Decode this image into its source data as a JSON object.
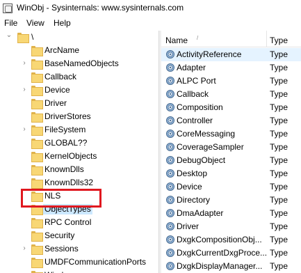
{
  "window": {
    "title": "WinObj - Sysinternals: www.sysinternals.com"
  },
  "menu": {
    "file": "File",
    "view": "View",
    "help": "Help"
  },
  "tree": {
    "root": {
      "label": "\\",
      "expand_glyph": "⌄"
    },
    "collapsed_glyph": "›",
    "selected": "ObjectTypes",
    "items": [
      {
        "label": "ArcName",
        "expandable": false
      },
      {
        "label": "BaseNamedObjects",
        "expandable": true
      },
      {
        "label": "Callback",
        "expandable": false
      },
      {
        "label": "Device",
        "expandable": true
      },
      {
        "label": "Driver",
        "expandable": false
      },
      {
        "label": "DriverStores",
        "expandable": false
      },
      {
        "label": "FileSystem",
        "expandable": true
      },
      {
        "label": "GLOBAL??",
        "expandable": false
      },
      {
        "label": "KernelObjects",
        "expandable": false
      },
      {
        "label": "KnownDlls",
        "expandable": false
      },
      {
        "label": "KnownDlls32",
        "expandable": false
      },
      {
        "label": "NLS",
        "expandable": false
      },
      {
        "label": "ObjectTypes",
        "expandable": false
      },
      {
        "label": "RPC Control",
        "expandable": false
      },
      {
        "label": "Security",
        "expandable": false
      },
      {
        "label": "Sessions",
        "expandable": true
      },
      {
        "label": "UMDFCommunicationPorts",
        "expandable": false
      },
      {
        "label": "Windows",
        "expandable": true
      }
    ]
  },
  "list": {
    "columns": {
      "name": "Name",
      "type": "Type"
    },
    "sort_glyph": "/",
    "rows": [
      {
        "name": "ActivityReference",
        "type": "Type"
      },
      {
        "name": "Adapter",
        "type": "Type"
      },
      {
        "name": "ALPC Port",
        "type": "Type"
      },
      {
        "name": "Callback",
        "type": "Type"
      },
      {
        "name": "Composition",
        "type": "Type"
      },
      {
        "name": "Controller",
        "type": "Type"
      },
      {
        "name": "CoreMessaging",
        "type": "Type"
      },
      {
        "name": "CoverageSampler",
        "type": "Type"
      },
      {
        "name": "DebugObject",
        "type": "Type"
      },
      {
        "name": "Desktop",
        "type": "Type"
      },
      {
        "name": "Device",
        "type": "Type"
      },
      {
        "name": "Directory",
        "type": "Type"
      },
      {
        "name": "DmaAdapter",
        "type": "Type"
      },
      {
        "name": "Driver",
        "type": "Type"
      },
      {
        "name": "DxgkCompositionObj...",
        "type": "Type"
      },
      {
        "name": "DxgkCurrentDxgProce...",
        "type": "Type"
      },
      {
        "name": "DxgkDisplayManager...",
        "type": "Type"
      }
    ]
  },
  "colors": {
    "selection": "#cce8ff",
    "highlight_box": "#e0181f",
    "folder": "#f8d775",
    "hover_row": "#e5f3ff"
  },
  "icons": {
    "app": "winobj-app-icon",
    "folder": "folder-icon",
    "object_type": "gear-icon"
  }
}
